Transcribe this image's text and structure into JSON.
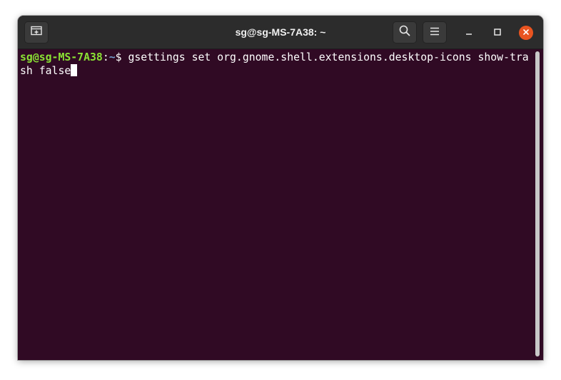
{
  "window": {
    "title": "sg@sg-MS-7A38: ~"
  },
  "toolbar": {
    "new_tab_icon": "new-tab-icon",
    "search_icon": "search-icon",
    "menu_icon": "hamburger-menu-icon",
    "minimize_icon": "minimize-icon",
    "maximize_icon": "maximize-icon",
    "close_icon": "close-icon"
  },
  "terminal": {
    "prompt_user": "sg@sg-MS-7A38",
    "prompt_sep": ":",
    "prompt_path": "~",
    "prompt_symbol": "$ ",
    "command_line1": "gsettings set org.gnome.shell.extensions.desktop-icons show-tra",
    "command_line2": "sh false"
  },
  "colors": {
    "terminal_bg": "#300a24",
    "titlebar_bg": "#2c2c2c",
    "prompt_user": "#8ae234",
    "prompt_path": "#729fcf",
    "close_button": "#e95420"
  }
}
